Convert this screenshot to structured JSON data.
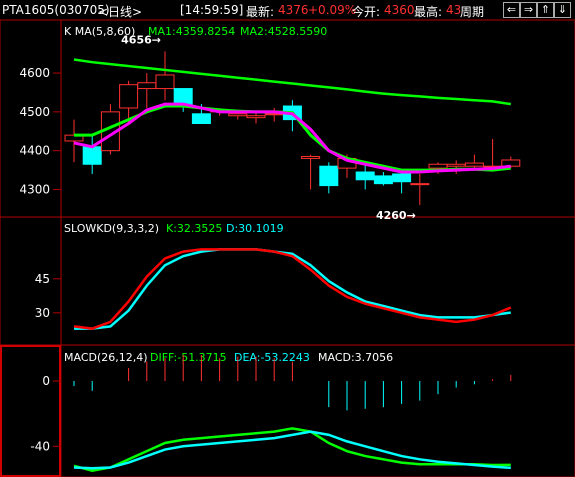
{
  "header": {
    "symbol": "PTA1605(030705)",
    "period": "<日线>",
    "time": "[14:59:59]",
    "latest_label": "最新:",
    "latest_value": "4376",
    "change_pct": "+0.09%",
    "open_label": "今开:",
    "open_value": "4360",
    "high_label": "最高:",
    "high_value": "43",
    "period_button": "周期",
    "nav_buttons": [
      "⇐",
      "⇒",
      "⇑",
      "⇓"
    ]
  },
  "colors": {
    "up": "#ff3030",
    "down": "#00ffff",
    "ma1": "#ff00ff",
    "ma2": "#00ff00",
    "k": "#ff0000",
    "d": "#00ffff",
    "dea": "#00ffff",
    "diff": "#00ff00",
    "frame": "#b00000"
  },
  "panels": {
    "price_title": "K  MA(5,8,60)",
    "ma1_label": "MA1:4359.8254",
    "ma2_label": "MA2:4528.5590",
    "kd_title": "SLOWKD(9,3,3,2)",
    "k_label": "K:32.3525",
    "d_label": "D:30.1019",
    "macd_title": "MACD(26,12,4)",
    "diff_label": "DIFF:-51.3715",
    "dea_label": "DEA:-53.2243",
    "macd_label": "MACD:3.7056"
  },
  "chart_data": [
    {
      "type": "candlestick",
      "ylim": [
        4260,
        4680
      ],
      "yticks": [
        4300,
        4400,
        4500,
        4600
      ],
      "candles": [
        {
          "o": 4425,
          "h": 4480,
          "l": 4370,
          "c": 4440
        },
        {
          "o": 4410,
          "h": 4440,
          "l": 4340,
          "c": 4365
        },
        {
          "o": 4400,
          "h": 4520,
          "l": 4390,
          "c": 4500
        },
        {
          "o": 4510,
          "h": 4580,
          "l": 4470,
          "c": 4570
        },
        {
          "o": 4560,
          "h": 4600,
          "l": 4510,
          "c": 4575
        },
        {
          "o": 4560,
          "h": 4656,
          "l": 4530,
          "c": 4595
        },
        {
          "o": 4560,
          "h": 4560,
          "l": 4500,
          "c": 4515
        },
        {
          "o": 4495,
          "h": 4520,
          "l": 4470,
          "c": 4470
        },
        {
          "o": 4500,
          "h": 4510,
          "l": 4490,
          "c": 4505
        },
        {
          "o": 4490,
          "h": 4505,
          "l": 4480,
          "c": 4495
        },
        {
          "o": 4485,
          "h": 4500,
          "l": 4470,
          "c": 4490
        },
        {
          "o": 4495,
          "h": 4510,
          "l": 4475,
          "c": 4495
        },
        {
          "o": 4515,
          "h": 4530,
          "l": 4450,
          "c": 4480
        },
        {
          "o": 4380,
          "h": 4390,
          "l": 4300,
          "c": 4385
        },
        {
          "o": 4360,
          "h": 4370,
          "l": 4290,
          "c": 4310
        },
        {
          "o": 4355,
          "h": 4390,
          "l": 4330,
          "c": 4380
        },
        {
          "o": 4345,
          "h": 4365,
          "l": 4300,
          "c": 4325
        },
        {
          "o": 4335,
          "h": 4345,
          "l": 4310,
          "c": 4315
        },
        {
          "o": 4340,
          "h": 4350,
          "l": 4290,
          "c": 4320
        },
        {
          "o": 4315,
          "h": 4340,
          "l": 4260,
          "c": 4315
        },
        {
          "o": 4355,
          "h": 4370,
          "l": 4340,
          "c": 4365
        },
        {
          "o": 4360,
          "h": 4375,
          "l": 4340,
          "c": 4365
        },
        {
          "o": 4360,
          "h": 4390,
          "l": 4350,
          "c": 4368
        },
        {
          "o": 4360,
          "h": 4430,
          "l": 4350,
          "c": 4360
        },
        {
          "o": 4360,
          "h": 4385,
          "l": 4355,
          "c": 4376
        }
      ],
      "ma1": [
        4420,
        4410,
        4440,
        4470,
        4505,
        4520,
        4520,
        4510,
        4500,
        4500,
        4500,
        4500,
        4495,
        4455,
        4400,
        4375,
        4365,
        4355,
        4345,
        4345,
        4348,
        4350,
        4352,
        4354,
        4360
      ],
      "ma2": [
        4635,
        4628,
        4623,
        4618,
        4613,
        4608,
        4603,
        4598,
        4593,
        4588,
        4583,
        4578,
        4573,
        4568,
        4563,
        4558,
        4552,
        4547,
        4543,
        4540,
        4536,
        4533,
        4530,
        4527,
        4520
      ],
      "ma_green": [
        4440,
        4440,
        4460,
        4480,
        4500,
        4515,
        4515,
        4510,
        4505,
        4502,
        4500,
        4500,
        4498,
        4440,
        4400,
        4380,
        4370,
        4360,
        4350,
        4350,
        4350,
        4352,
        4352,
        4350,
        4355
      ],
      "annotations": [
        {
          "label": "4656",
          "x": 5,
          "y": 4656
        },
        {
          "label": "4260",
          "x": 19,
          "y": 4260
        }
      ]
    },
    {
      "type": "line",
      "ylim": [
        18,
        63
      ],
      "yticks": [
        30,
        45
      ],
      "series": [
        {
          "name": "K",
          "values": [
            24,
            23,
            26,
            35,
            46,
            54,
            57,
            58,
            58,
            58,
            58,
            57,
            55,
            49,
            42,
            37,
            34,
            32,
            30,
            28,
            27,
            26,
            27,
            29,
            32.35
          ]
        },
        {
          "name": "D",
          "values": [
            23,
            23,
            24,
            31,
            42,
            51,
            55,
            57,
            58,
            58,
            58,
            57,
            56,
            51,
            44,
            39,
            35,
            33,
            31,
            29,
            28,
            28,
            28,
            29,
            30.1
          ]
        }
      ]
    },
    {
      "type": "line",
      "ylim": [
        -57,
        8
      ],
      "yticks": [
        -40,
        0
      ],
      "series": [
        {
          "name": "DIFF",
          "values": [
            -52,
            -55,
            -53,
            -48,
            -43,
            -38,
            -36,
            -35,
            -34,
            -33,
            -32,
            -31,
            -29,
            -31,
            -38,
            -43,
            -46,
            -48,
            -50,
            -51,
            -51,
            -51,
            -51,
            -51.5,
            -51.37
          ]
        },
        {
          "name": "DEA",
          "values": [
            -53,
            -53.5,
            -53,
            -50,
            -46,
            -42,
            -40,
            -39,
            -38,
            -37,
            -36,
            -35,
            -33,
            -31,
            -33,
            -37,
            -40,
            -43,
            -46,
            -48,
            -49.5,
            -50.5,
            -51.5,
            -52.5,
            -53.22
          ]
        },
        {
          "name": "MACD",
          "values": [
            -3,
            -6,
            0,
            8,
            12,
            14,
            16,
            16,
            14,
            15,
            15,
            14,
            12,
            0,
            -16,
            -18,
            -17,
            -16,
            -14,
            -12,
            -8,
            -4,
            -2,
            1,
            3.71
          ]
        }
      ]
    }
  ]
}
